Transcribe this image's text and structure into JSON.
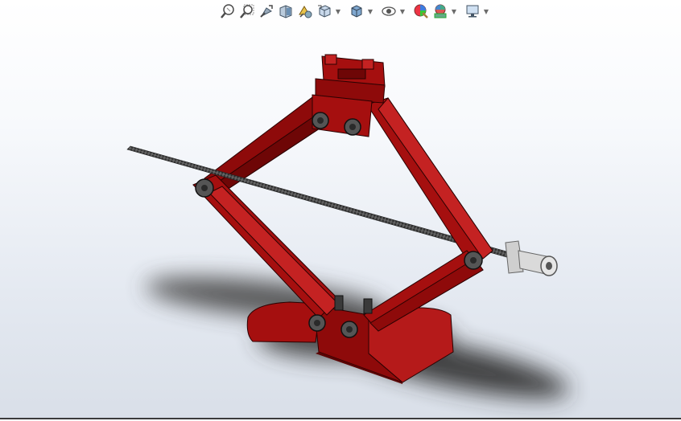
{
  "window": {
    "width": 846,
    "height": 522
  },
  "toolbar": {
    "items": [
      {
        "icon": "zoom-to-fit-icon",
        "dropdown": false
      },
      {
        "icon": "zoom-to-area-icon",
        "dropdown": false
      },
      {
        "icon": "previous-view-icon",
        "dropdown": false
      },
      {
        "icon": "section-view-icon",
        "dropdown": false
      },
      {
        "icon": "dynamic-annotation-views-icon",
        "dropdown": false
      },
      {
        "icon": "view-orientation-icon",
        "dropdown": true
      },
      {
        "icon": "display-style-icon",
        "dropdown": true
      },
      {
        "icon": "hide-show-items-icon",
        "dropdown": true
      },
      {
        "icon": "edit-appearance-icon",
        "dropdown": false
      },
      {
        "icon": "apply-scene-icon",
        "dropdown": true
      },
      {
        "icon": "view-settings-icon",
        "dropdown": true
      }
    ]
  },
  "model": {
    "name": "scissor-jack",
    "colors": {
      "body": "#a50f0f",
      "body_dark": "#6e0606",
      "body_light": "#c42222",
      "screw": "#4a4a4a",
      "eye_bolt": "#cfcfcf",
      "shadow": "#3a3a3a"
    }
  }
}
